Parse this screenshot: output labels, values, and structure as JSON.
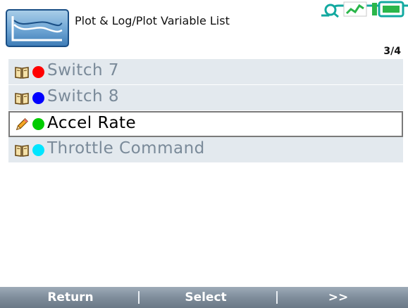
{
  "header": {
    "title": "Plot & Log/Plot Variable List",
    "page_indicator": "3/4",
    "app_icon": "plot-chart-icon"
  },
  "status": {
    "icons": [
      "usb-connection-icon",
      "signal-chart-icon",
      "battery-icon"
    ],
    "accent": "#12a9a0"
  },
  "list": {
    "items": [
      {
        "label": "Switch 7",
        "icon": "book-icon",
        "color": "#ff0000",
        "selected": false
      },
      {
        "label": "Switch 8",
        "icon": "book-icon",
        "color": "#0000ff",
        "selected": false
      },
      {
        "label": "Accel Rate",
        "icon": "pencil-icon",
        "color": "#00cc00",
        "selected": true
      },
      {
        "label": "Throttle Command",
        "icon": "book-icon",
        "color": "#00e5ff",
        "selected": false
      }
    ]
  },
  "softkeys": {
    "return_label": "Return",
    "select_label": "Select",
    "next_label": ">>"
  }
}
